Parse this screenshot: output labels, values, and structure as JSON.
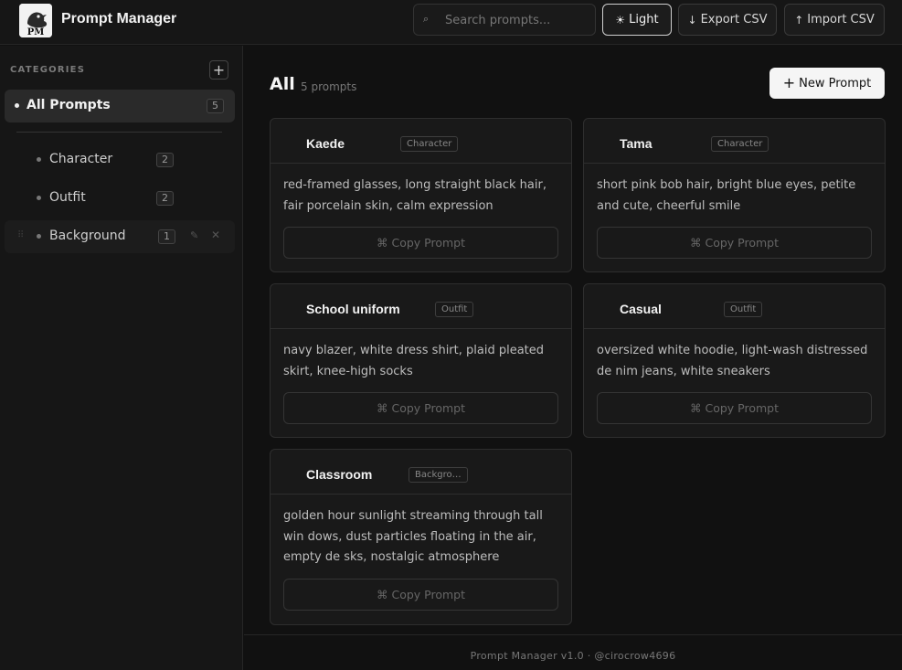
{
  "app": {
    "title": "Prompt Manager",
    "logo_text": "PM"
  },
  "header": {
    "search_placeholder": "Search prompts...",
    "search_icon": "⌕",
    "light_icon": "☀",
    "light_label": "Light",
    "export_icon": "↓",
    "export_label": "Export CSV",
    "import_icon": "↑",
    "import_label": "Import CSV"
  },
  "sidebar": {
    "section_title": "CATEGORIES",
    "add_label": "+",
    "all": {
      "label": "All Prompts",
      "count": "5"
    },
    "items": [
      {
        "label": "Character",
        "count": "2"
      },
      {
        "label": "Outfit",
        "count": "2"
      },
      {
        "label": "Background",
        "count": "1",
        "drag": "⠿",
        "edit": "✎",
        "delete": "✕"
      }
    ]
  },
  "main": {
    "title": "All",
    "count_text": "5 prompts",
    "new_plus": "+",
    "new_label": "New Prompt",
    "copy_icon": "⌘",
    "copy_label": "Copy Prompt",
    "cards": [
      {
        "name": "Kaede",
        "tag": "Character",
        "text": "red-framed glasses, long straight black hair, fair porcelain skin, calm expression"
      },
      {
        "name": "Tama",
        "tag": "Character",
        "text": "short pink bob hair, bright blue eyes, petite and cute, cheerful smile"
      },
      {
        "name": "School uniform",
        "tag": "Outfit",
        "text": "navy blazer, white dress shirt, plaid pleated skirt, knee-high socks"
      },
      {
        "name": "Casual",
        "tag": "Outfit",
        "text": "oversized white hoodie, light-wash distressed de nim jeans, white sneakers"
      },
      {
        "name": "Classroom",
        "tag": "Backgro…",
        "text": "golden hour sunlight streaming through tall win dows, dust particles floating in the air, empty de sks, nostalgic atmosphere"
      }
    ]
  },
  "footer": {
    "text": "Prompt Manager v1.0 · @cirocrow4696"
  },
  "colors": {
    "background": "#111111",
    "surface": "#191919",
    "accent": "#f5f5f5"
  }
}
